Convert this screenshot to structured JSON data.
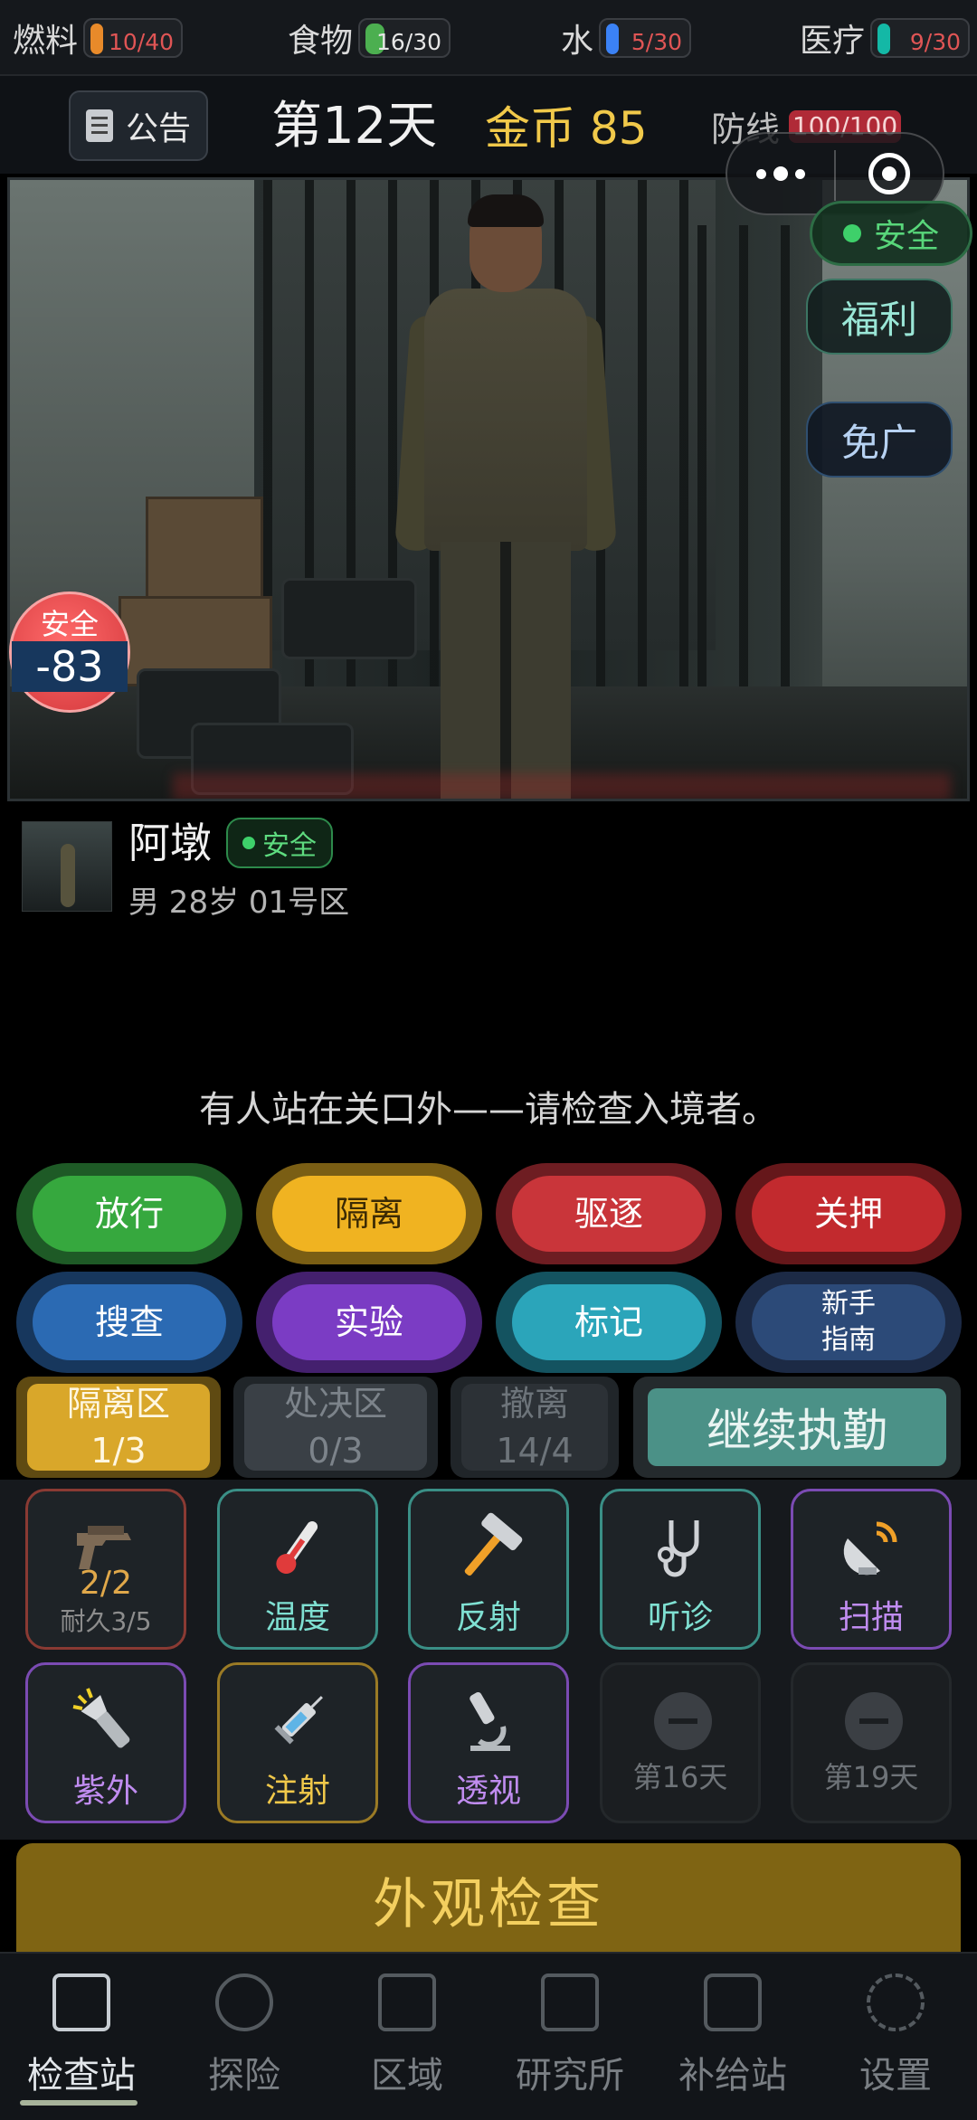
{
  "resources": [
    {
      "label": "燃料",
      "value": "10/40",
      "color": "#e88a2a",
      "fraction": 0.25
    },
    {
      "label": "食物",
      "value": "16/30",
      "color": "#4caf50",
      "fraction": 0.53
    },
    {
      "label": "水",
      "value": "5/30",
      "color": "#3b82f6",
      "fraction": 0.17
    },
    {
      "label": "医疗",
      "value": "9/30",
      "color": "#14b8a6",
      "fraction": 0.3
    }
  ],
  "header": {
    "notice_label": "公告",
    "day": "第12天",
    "gold": "金币 85",
    "defense_label": "防线",
    "defense_value": "100/100"
  },
  "scene_overlay": {
    "status": "安全",
    "welfare": "福利",
    "no_ads": "免广",
    "safety_label": "安全",
    "safety_value": "-83"
  },
  "subject": {
    "name": "阿墩",
    "status": "安全",
    "details": "男 28岁  01号区"
  },
  "prompt": "有人站在关口外——请检查入境者。",
  "actions": [
    {
      "label": "放行",
      "style": "g"
    },
    {
      "label": "隔离",
      "style": "y"
    },
    {
      "label": "驱逐",
      "style": "r"
    },
    {
      "label": "关押",
      "style": "r2"
    },
    {
      "label": "搜查",
      "style": "b"
    },
    {
      "label": "实验",
      "style": "p"
    },
    {
      "label": "标记",
      "style": "t"
    },
    {
      "label": "新手\n指南",
      "style": "n"
    }
  ],
  "zones": [
    {
      "name": "隔离区",
      "count": "1/3",
      "active": true
    },
    {
      "name": "处决区",
      "count": "0/3",
      "active": false
    },
    {
      "name": "撤离",
      "count": "14/4",
      "active": false
    }
  ],
  "continue_label": "继续执勤",
  "tools": [
    {
      "label": "2/2",
      "sub": "耐久3/5",
      "icon": "pistol-icon",
      "color": "#e0a84a",
      "border": "#8a3a33"
    },
    {
      "label": "温度",
      "icon": "thermometer-icon",
      "color": "#7fe0d2",
      "border": "#3a8f86"
    },
    {
      "label": "反射",
      "icon": "hammer-icon",
      "color": "#7fe0d2",
      "border": "#3a8f86"
    },
    {
      "label": "听诊",
      "icon": "stethoscope-icon",
      "color": "#7fe0d2",
      "border": "#3a8f86"
    },
    {
      "label": "扫描",
      "icon": "satellite-dish-icon",
      "color": "#c08cf0",
      "border": "#7b4bb3"
    },
    {
      "label": "紫外",
      "icon": "flashlight-icon",
      "color": "#c08cf0",
      "border": "#7b4bb3"
    },
    {
      "label": "注射",
      "icon": "syringe-icon",
      "color": "#f0c84a",
      "border": "#9a7a25"
    },
    {
      "label": "透视",
      "icon": "microscope-icon",
      "color": "#c08cf0",
      "border": "#7b4bb3"
    },
    {
      "label": "第16天",
      "icon": "locked-icon",
      "locked": true
    },
    {
      "label": "第19天",
      "icon": "locked-icon",
      "locked": true
    }
  ],
  "big_button": "外观检查",
  "nav": [
    {
      "label": "检查站",
      "icon": "checkpoint-icon",
      "active": true
    },
    {
      "label": "探险",
      "icon": "compass-icon",
      "active": false
    },
    {
      "label": "区域",
      "icon": "map-icon",
      "active": false
    },
    {
      "label": "研究所",
      "icon": "lab-icon",
      "active": false
    },
    {
      "label": "补给站",
      "icon": "supply-icon",
      "active": false
    },
    {
      "label": "设置",
      "icon": "gear-icon",
      "active": false
    }
  ]
}
